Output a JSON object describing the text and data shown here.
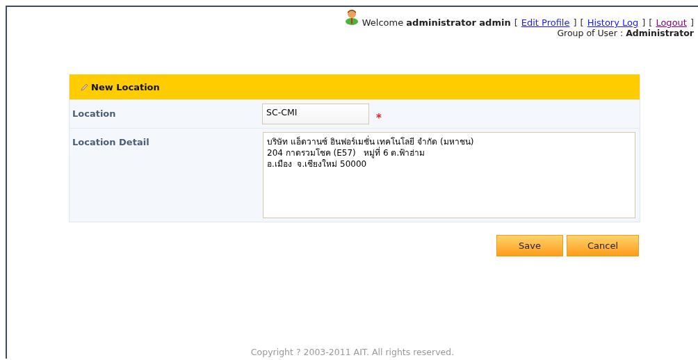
{
  "header": {
    "welcome": "Welcome",
    "user_name": "administrator admin",
    "links": [
      {
        "open": "[",
        "label": "Edit Profile",
        "close": "]",
        "visited": false
      },
      {
        "open": "[",
        "label": "History Log",
        "close": "]",
        "visited": false
      },
      {
        "open": "[",
        "label": "Logout",
        "close": "]",
        "visited": true
      }
    ],
    "group_label": "Group of User :",
    "group_value": "Administrator"
  },
  "form": {
    "title": "New Location",
    "fields": [
      {
        "kind": "input",
        "label": "Location",
        "value": "SC-CMI",
        "required_mark": "*"
      },
      {
        "kind": "textarea",
        "label": "Location Detail",
        "value": "บริษัท แอ็ดวานซ์ อินฟอร์เมชั่น เทคโนโลยี จำกัด (มหาชน)\n204 กาดรวมโชค (E57)   หมู่ที่ 6 ต.ฟ้าฮ่าม\nอ.เมือง  จ.เชียงใหม่ 50000"
      }
    ],
    "buttons": [
      "Save",
      "Cancel"
    ]
  },
  "footer": "Copyright ? 2003-2011 AIT. All rights reserved."
}
